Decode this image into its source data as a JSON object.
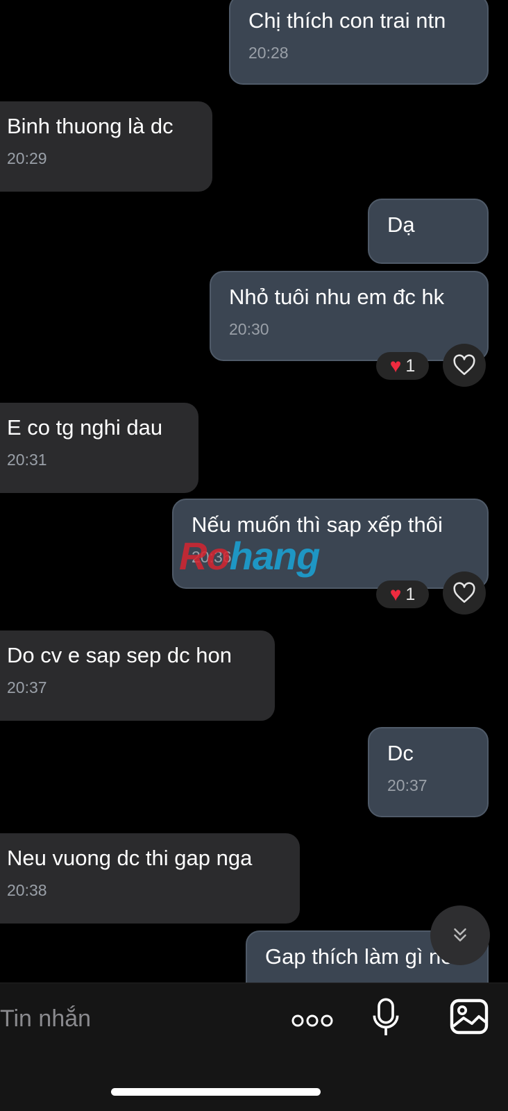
{
  "messages": [
    {
      "text": "Chị thích con trai ntn",
      "time": "20:28"
    },
    {
      "text": "Binh thuong là dc",
      "time": "20:29"
    },
    {
      "text": "Dạ"
    },
    {
      "text": "Nhỏ tuôi nhu em đc hk",
      "time": "20:30",
      "reaction_count": "1"
    },
    {
      "text": "E co tg nghi dau",
      "time": "20:31"
    },
    {
      "text": "Nếu muốn thì sap xếp thôi",
      "time": "20:36",
      "reaction_count": "1"
    },
    {
      "text": "Do cv e sap sep dc hon",
      "time": "20:37"
    },
    {
      "text": "Dc",
      "time": "20:37"
    },
    {
      "text": "Neu vuong dc thi gap nga",
      "time": "20:38"
    },
    {
      "text": "Gap thích làm gì ne"
    }
  ],
  "watermark": {
    "part1": "Ro",
    "part2": "hang"
  },
  "composer": {
    "placeholder": "Tin nhắn",
    "icons": [
      "more-icon",
      "microphone-icon",
      "image-icon"
    ]
  },
  "colors": {
    "outgoing_bubble": "#3b4552",
    "incoming_bubble": "#2b2b2d",
    "heart": "#ef2b3f"
  }
}
